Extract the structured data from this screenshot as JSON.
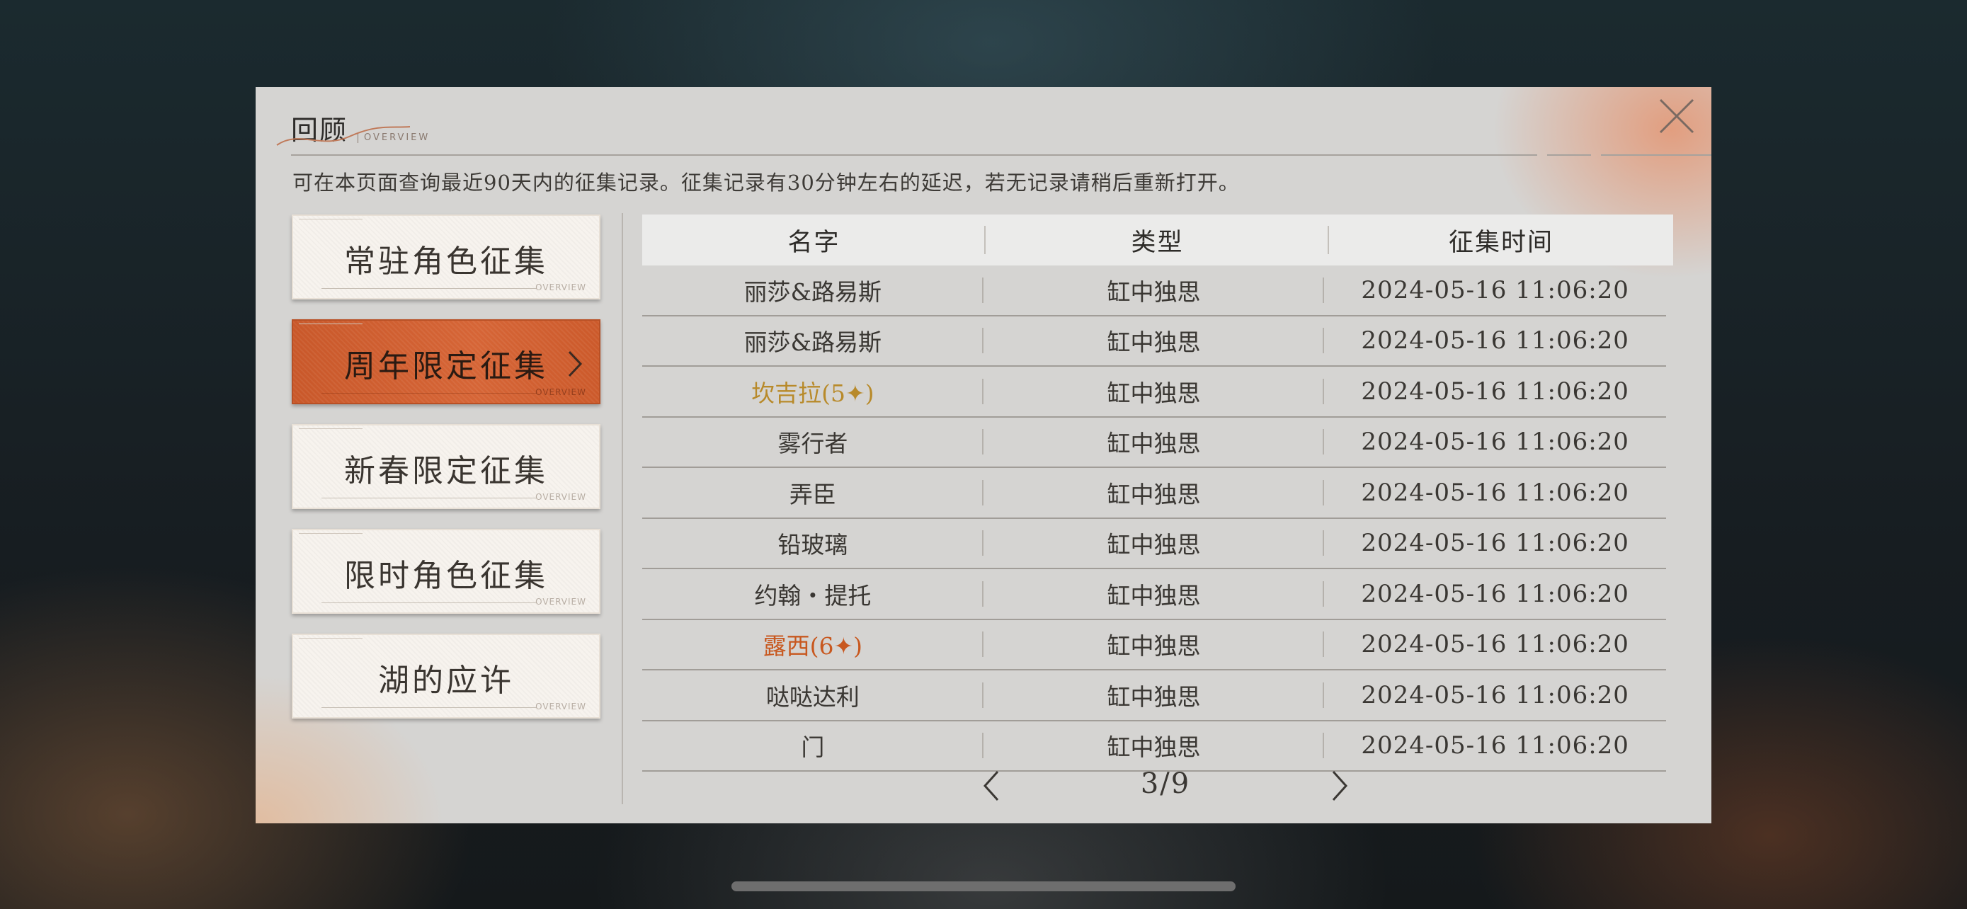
{
  "dialog": {
    "title": "回顾",
    "title_sub": "OVERVIEW",
    "description": "可在本页面查询最近90天内的征集记录。征集记录有30分钟左右的延迟，若无记录请稍后重新打开。"
  },
  "tabs": [
    {
      "label": "常驻角色征集",
      "active": false
    },
    {
      "label": "周年限定征集",
      "active": true
    },
    {
      "label": "新春限定征集",
      "active": false
    },
    {
      "label": "限时角色征集",
      "active": false
    },
    {
      "label": "湖的应许",
      "active": false
    }
  ],
  "tab_foot_text": "OVERVIEW",
  "table": {
    "headers": [
      "名字",
      "类型",
      "征集时间"
    ],
    "rows": [
      {
        "name": "丽莎&路易斯",
        "type": "缸中独思",
        "time": "2024-05-16 11:06:20",
        "rarity": ""
      },
      {
        "name": "丽莎&路易斯",
        "type": "缸中独思",
        "time": "2024-05-16 11:06:20",
        "rarity": ""
      },
      {
        "name": "坎吉拉(5✦)",
        "type": "缸中独思",
        "time": "2024-05-16 11:06:20",
        "rarity": "5"
      },
      {
        "name": "雾行者",
        "type": "缸中独思",
        "time": "2024-05-16 11:06:20",
        "rarity": ""
      },
      {
        "name": "弄臣",
        "type": "缸中独思",
        "time": "2024-05-16 11:06:20",
        "rarity": ""
      },
      {
        "name": "铅玻璃",
        "type": "缸中独思",
        "time": "2024-05-16 11:06:20",
        "rarity": ""
      },
      {
        "name": "约翰・提托",
        "type": "缸中独思",
        "time": "2024-05-16 11:06:20",
        "rarity": ""
      },
      {
        "name": "露西(6✦)",
        "type": "缸中独思",
        "time": "2024-05-16 11:06:20",
        "rarity": "6"
      },
      {
        "name": "哒哒达利",
        "type": "缸中独思",
        "time": "2024-05-16 11:06:20",
        "rarity": ""
      },
      {
        "name": "门",
        "type": "缸中独思",
        "time": "2024-05-16 11:06:20",
        "rarity": ""
      }
    ]
  },
  "pager": {
    "text": "3/9"
  },
  "colors": {
    "accent": "#d1602f",
    "rarity5": "#b88a2a",
    "rarity6": "#c8581f",
    "panel": "#d5d4d2"
  },
  "icons": {
    "close": "close-icon",
    "tab_arrow": "chevron-right-icon",
    "prev": "chevron-left-icon",
    "next": "chevron-right-icon"
  }
}
